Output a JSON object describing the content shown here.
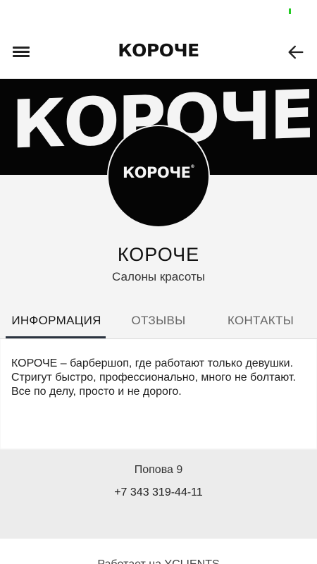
{
  "app_bar": {
    "logo": "КОРОЧЕ",
    "menu_icon": "hamburger-icon",
    "back_icon": "arrow-left-icon"
  },
  "banner": {
    "text": "КОРОЧЕ"
  },
  "profile": {
    "avatar_text": "КОРОЧЕ",
    "name": "КОРОЧЕ",
    "category": "Салоны красоты"
  },
  "tabs": [
    {
      "label": "ИНФОРМАЦИЯ",
      "active": true
    },
    {
      "label": "ОТЗЫВЫ",
      "active": false
    },
    {
      "label": "КОНТАКТЫ",
      "active": false
    }
  ],
  "info": {
    "description": "КОРОЧЕ – барбершоп, где работают только девушки. Стригут быстро, профессионально, много не болтают. Все по делу, просто и не дорого."
  },
  "contacts": {
    "address": "Попова 9",
    "phone": "+7 343 319-44-11"
  },
  "footer": {
    "text": "Работает на YCLIENTS"
  },
  "colors": {
    "status_indicator": "#22cc22",
    "banner_bg": "#050505",
    "tab_underline": "#2b3440",
    "contacts_bg": "#ececec"
  }
}
